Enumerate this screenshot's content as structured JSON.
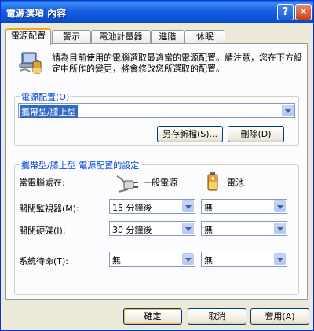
{
  "window": {
    "title": "電源選項 內容",
    "help_glyph": "?",
    "close_glyph": "✕"
  },
  "tabs": [
    {
      "label": "電源配置",
      "active": true
    },
    {
      "label": "警示"
    },
    {
      "label": "電池計量器"
    },
    {
      "label": "進階"
    },
    {
      "label": "休眠"
    }
  ],
  "intro": "請為目前使用的電腦選取最適當的電源配置。請注意，您在下方設定中所作的變更，將會修改您所選取的配置。",
  "scheme_group": {
    "label": "電源配置(O)",
    "selected": "攜帶型/膝上型",
    "save_as_label": "另存新檔(S)...",
    "delete_label": "刪除(D)"
  },
  "settings_group": {
    "label": "攜帶型/膝上型 電源配置的設定",
    "when_label": "當電腦處在:",
    "ac_label": "一般電源",
    "battery_label": "電池",
    "rows": [
      {
        "label": "關閉監視器(M):",
        "ac": "15 分鐘後",
        "dc": "無"
      },
      {
        "label": "關閉硬碟(I):",
        "ac": "30 分鐘後",
        "dc": "無"
      },
      {
        "label": "系統待命(T):",
        "ac": "無",
        "dc": "無"
      }
    ]
  },
  "footer": {
    "ok_label": "確定",
    "cancel_label": "取消",
    "apply_label": "套用(A)"
  }
}
